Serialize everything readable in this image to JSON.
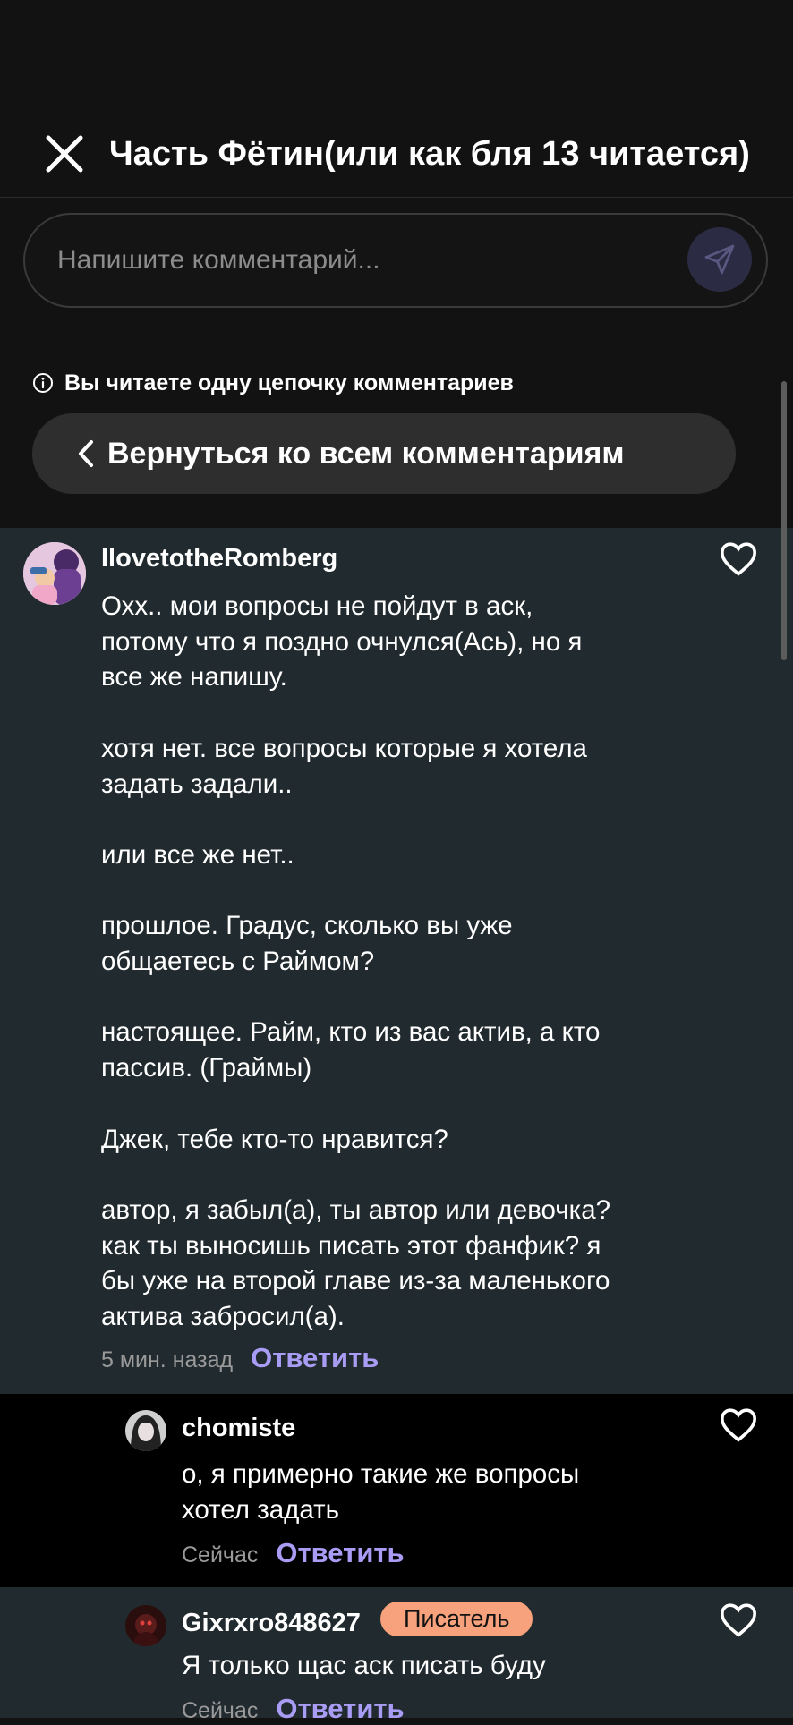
{
  "header": {
    "title": "Часть Фётин(или как бля 13 читается)",
    "close_icon": "close-icon"
  },
  "compose": {
    "placeholder": "Напишите комментарий...",
    "send_icon": "send-icon"
  },
  "thread_notice": {
    "text": "Вы читаете одну цепочку комментариев",
    "info_icon": "info-icon"
  },
  "back_button": {
    "label": "Вернуться ко всем комментариям",
    "icon": "chevron-left-icon"
  },
  "comments": [
    {
      "username": "IlovetotheRomberg",
      "text": "Охх.. мои вопросы не пойдут в аск,\nпотому что я поздно очнулся(Ась), но я\nвсе же напишу.\n\nхотя нет. все вопросы которые я хотела\nзадать задали..\n\nили все же нет..\n\nпрошлое. Градус, сколько вы уже\nобщаетесь с Раймом?\n\nнастоящее. Райм, кто из вас актив, а кто\nпассив. (Граймы)\n\nДжек, тебе кто-то нравится?\n\nавтор, я забыл(а), ты автор или девочка?\nкак ты выносишь писать этот фанфик? я\nбы уже на второй главе из-за маленького\nактива забросил(а).",
      "time": "5 мин. назад",
      "reply_label": "Ответить"
    },
    {
      "username": "chomiste",
      "text": "о, я примерно такие же вопросы\nхотел задать",
      "time": "Сейчас",
      "reply_label": "Ответить"
    },
    {
      "username": "Gixrxro848627",
      "badge": "Писатель",
      "text": "Я только щас аск писать буду",
      "time": "Сейчас",
      "reply_label": "Ответить"
    }
  ],
  "colors": {
    "background": "#121212",
    "comment_bg": "#212a2e",
    "reply_bg": "#000000",
    "accent": "#a99cf4",
    "badge": "#f7a27c",
    "send_button": "#2c2b44"
  }
}
